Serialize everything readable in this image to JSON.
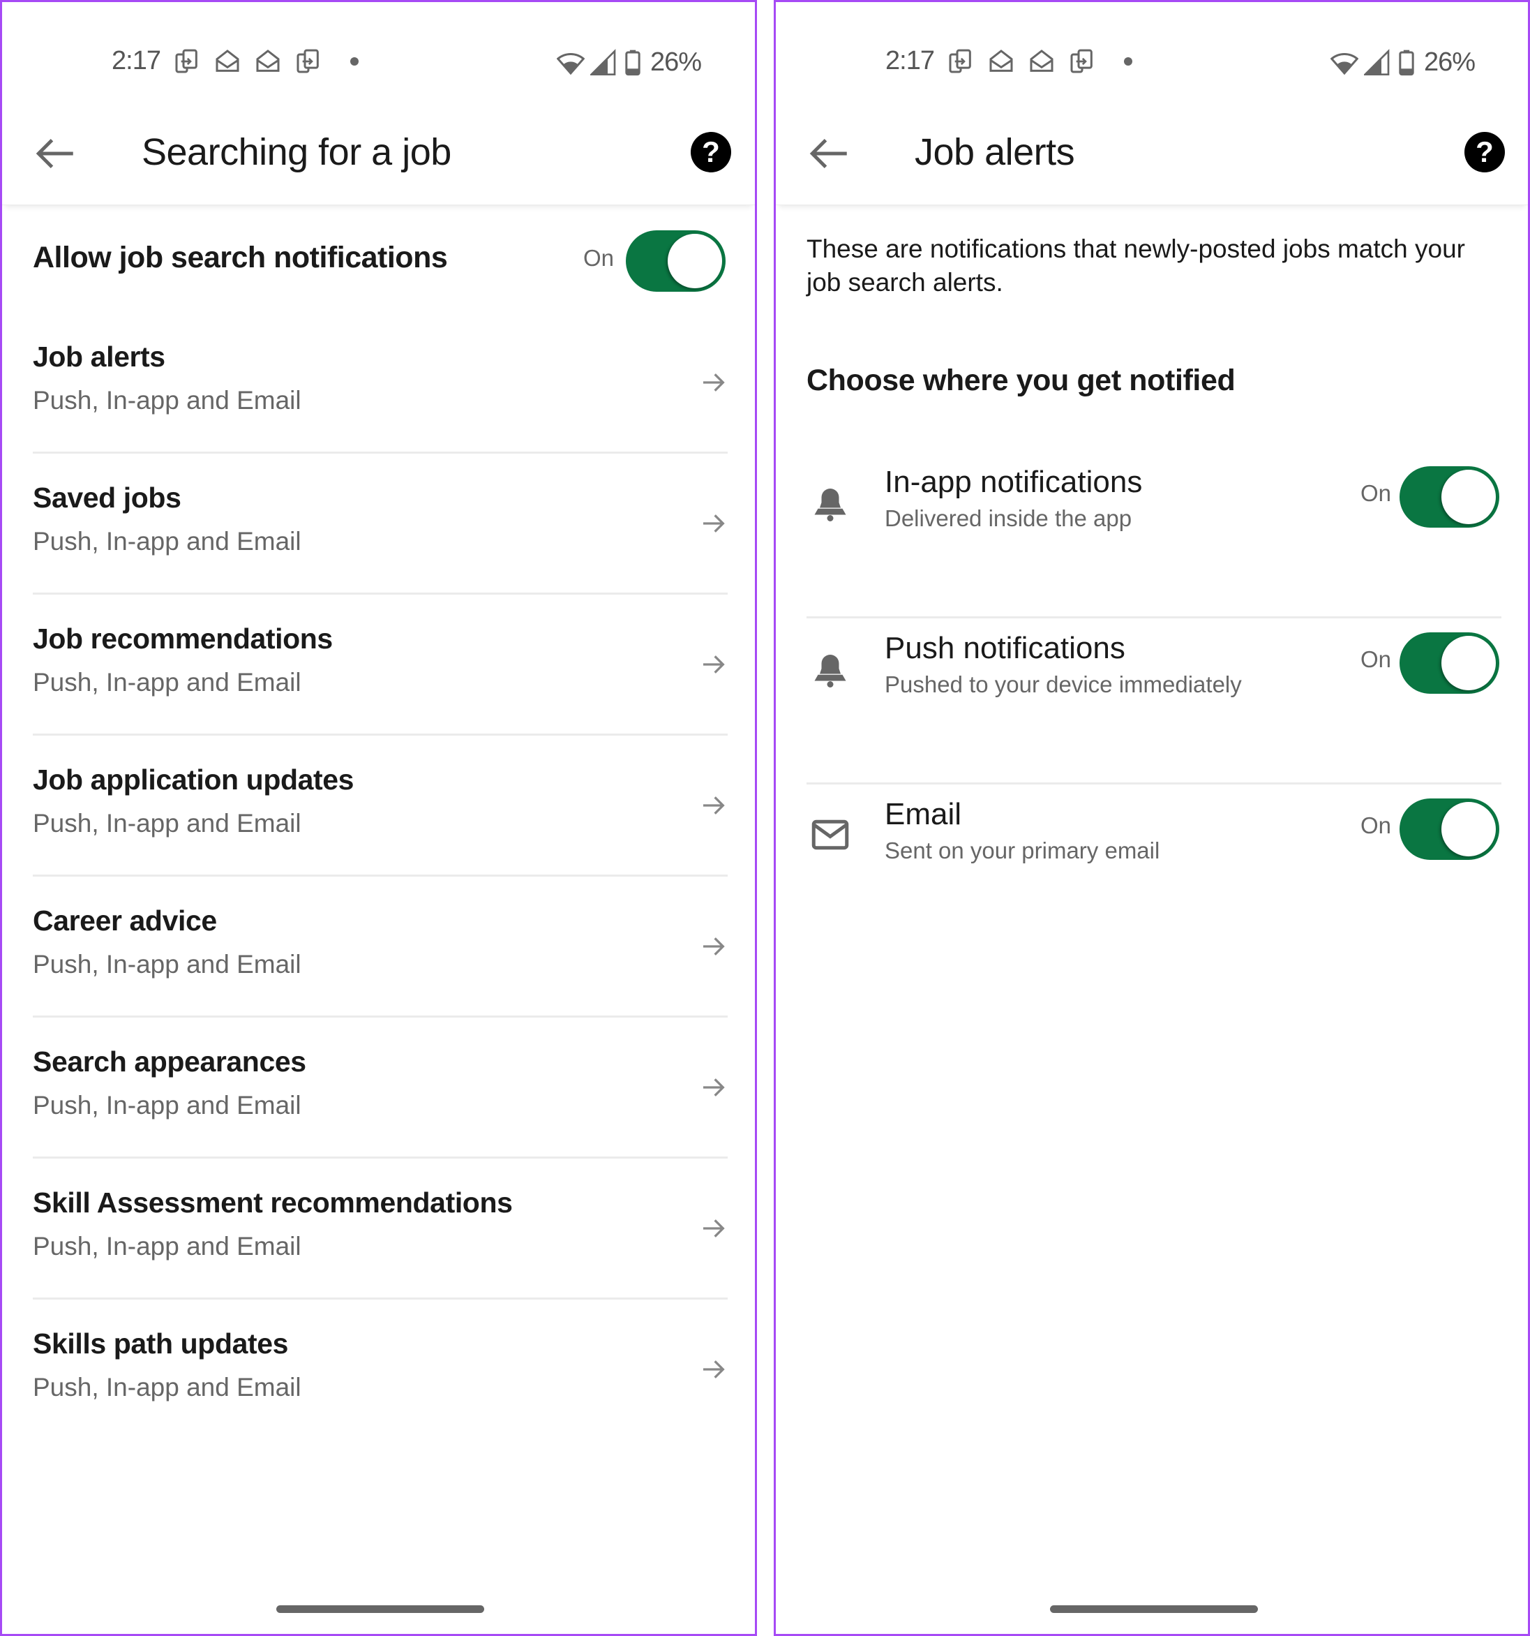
{
  "status_bar": {
    "time": "2:17",
    "left_icons": [
      "device-transfer-icon",
      "open-mail-icon",
      "open-mail-icon",
      "device-transfer-icon",
      "notification-dot-icon"
    ],
    "right_icons": [
      "wifi-icon",
      "cellular-signal-icon",
      "battery-icon"
    ],
    "battery_percent": "26%"
  },
  "colors": {
    "accent": "#0a7642",
    "frame": "#a64af5",
    "secondary_text": "#666666"
  },
  "left_screen": {
    "header": {
      "title": "Searching for a job",
      "back_icon": "arrow-left-icon",
      "help_icon": "help-circle-icon"
    },
    "master_toggle": {
      "label": "Allow job search notifications",
      "state_label": "On",
      "checked": true
    },
    "items": [
      {
        "title": "Job alerts",
        "subtitle": "Push, In-app and Email"
      },
      {
        "title": "Saved jobs",
        "subtitle": "Push, In-app and Email"
      },
      {
        "title": "Job recommendations",
        "subtitle": "Push, In-app and Email"
      },
      {
        "title": "Job application updates",
        "subtitle": "Push, In-app and Email"
      },
      {
        "title": "Career advice",
        "subtitle": "Push, In-app and Email"
      },
      {
        "title": "Search appearances",
        "subtitle": "Push, In-app and Email"
      },
      {
        "title": "Skill Assessment recommendations",
        "subtitle": "Push, In-app and Email"
      },
      {
        "title": "Skills path updates",
        "subtitle": "Push, In-app and Email"
      }
    ]
  },
  "right_screen": {
    "header": {
      "title": "Job alerts",
      "back_icon": "arrow-left-icon",
      "help_icon": "help-circle-icon"
    },
    "description": "These are notifications that newly-posted jobs match your job search alerts.",
    "section_heading": "Choose where you get notified",
    "channels": [
      {
        "icon": "bell-icon",
        "title": "In-app notifications",
        "subtitle": "Delivered inside the app",
        "state_label": "On",
        "checked": true
      },
      {
        "icon": "bell-icon",
        "title": "Push notifications",
        "subtitle": "Pushed to your device immediately",
        "state_label": "On",
        "checked": true
      },
      {
        "icon": "envelope-icon",
        "title": "Email",
        "subtitle": "Sent on your primary email",
        "state_label": "On",
        "checked": true
      }
    ]
  }
}
